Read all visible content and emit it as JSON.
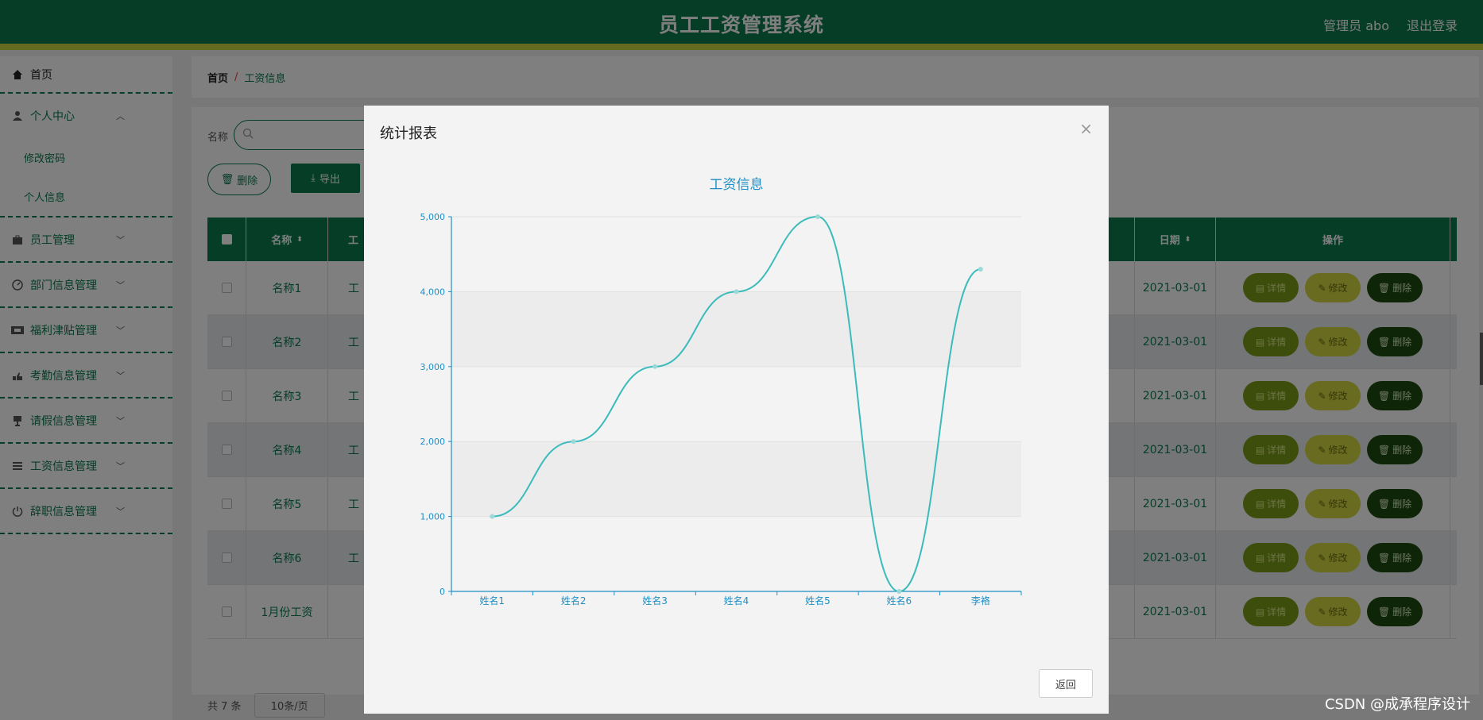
{
  "header": {
    "title": "员工工资管理系统",
    "user": "管理员 abo",
    "logout": "退出登录"
  },
  "sidebar": {
    "home": "首页",
    "items": [
      {
        "label": "个人中心",
        "icon": "user-icon",
        "sub": [
          "修改密码",
          "个人信息"
        ]
      },
      {
        "label": "员工管理",
        "icon": "briefcase-icon"
      },
      {
        "label": "部门信息管理",
        "icon": "gauge-icon"
      },
      {
        "label": "福利津贴管理",
        "icon": "ticket-icon"
      },
      {
        "label": "考勤信息管理",
        "icon": "hand-icon"
      },
      {
        "label": "请假信息管理",
        "icon": "cup-icon"
      },
      {
        "label": "工资信息管理",
        "icon": "list-icon"
      },
      {
        "label": "辞职信息管理",
        "icon": "power-icon"
      }
    ]
  },
  "breadcrumb": {
    "home": "首页",
    "sep": "/",
    "current": "工资信息"
  },
  "search": {
    "label": "名称",
    "value": ""
  },
  "toolbar": {
    "delete": "删除",
    "export": "导出"
  },
  "table": {
    "headers": {
      "name": "名称",
      "mid": "工",
      "date": "日期",
      "ops": "操作"
    },
    "rows": [
      {
        "name": "名称1",
        "mid": "工",
        "date": "2021-03-01"
      },
      {
        "name": "名称2",
        "mid": "工",
        "date": "2021-03-01"
      },
      {
        "name": "名称3",
        "mid": "工",
        "date": "2021-03-01"
      },
      {
        "name": "名称4",
        "mid": "工",
        "date": "2021-03-01"
      },
      {
        "name": "名称5",
        "mid": "工",
        "date": "2021-03-01"
      },
      {
        "name": "名称6",
        "mid": "工",
        "date": "2021-03-01"
      },
      {
        "name": "1月份工资",
        "mid": "",
        "date": "2021-03-01"
      }
    ],
    "ops": {
      "detail": "详情",
      "edit": "修改",
      "delete": "删除"
    }
  },
  "pager": {
    "total": "共 7 条",
    "size": "10条/页"
  },
  "modal": {
    "title": "统计报表",
    "close": "×",
    "back": "返回"
  },
  "chart_data": {
    "type": "line",
    "title": "工资信息",
    "categories": [
      "姓名1",
      "姓名2",
      "姓名3",
      "姓名4",
      "姓名5",
      "姓名6",
      "李袼"
    ],
    "values": [
      1000,
      2000,
      3000,
      4000,
      5000,
      0,
      4300
    ],
    "ylim": [
      0,
      5000
    ],
    "yticks": [
      "0",
      "1,000",
      "2,000",
      "3,000",
      "4,000",
      "5,000"
    ],
    "grid": true,
    "color": "#3bbbbb",
    "label_color": "#1e8fc6"
  },
  "watermark": "CSDN @成承程序设计"
}
